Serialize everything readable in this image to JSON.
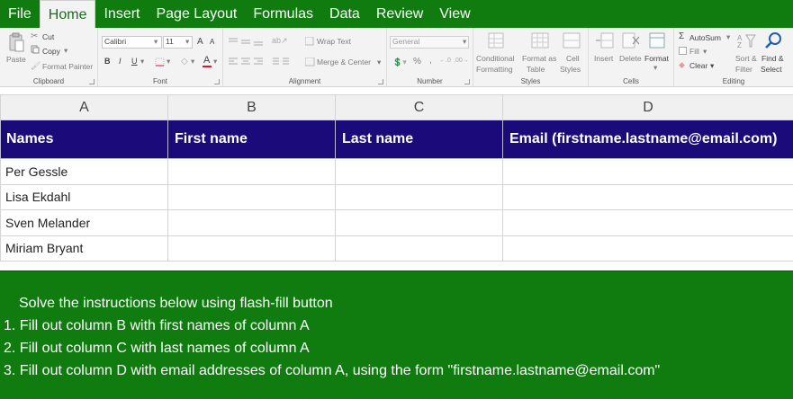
{
  "menu": {
    "items": [
      "File",
      "Home",
      "Insert",
      "Page Layout",
      "Formulas",
      "Data",
      "Review",
      "View"
    ],
    "active": "Home"
  },
  "ribbon": {
    "clipboard": {
      "label": "Clipboard",
      "paste": "Paste",
      "cut": "Cut",
      "copy": "Copy",
      "format_painter": "Format Painter"
    },
    "font": {
      "label": "Font",
      "font_name": "Calibri",
      "font_size": "11",
      "bold": "B",
      "italic": "I",
      "underline": "U",
      "grow": "A",
      "shrink": "A",
      "font_color_letter": "A",
      "font_color": "#e81123"
    },
    "alignment": {
      "label": "Alignment",
      "wrap_text": "Wrap Text",
      "merge_center": "Merge & Center"
    },
    "number": {
      "label": "Number",
      "format": "General",
      "percent": "%",
      "comma": ","
    },
    "styles": {
      "label": "Styles",
      "conditional_1": "Conditional",
      "conditional_2": "Formatting",
      "format_table_1": "Format as",
      "format_table_2": "Table",
      "cell_styles_1": "Cell",
      "cell_styles_2": "Styles"
    },
    "cells": {
      "label": "Cells",
      "insert": "Insert",
      "delete": "Delete",
      "format": "Format"
    },
    "editing": {
      "label": "Editing",
      "autosum": "AutoSum",
      "fill": "Fill",
      "clear": "Clear",
      "sort_1": "Sort &",
      "sort_2": "Filter",
      "find_1": "Find &",
      "find_2": "Select"
    }
  },
  "sheet": {
    "columns": [
      "A",
      "B",
      "C",
      "D"
    ],
    "header": [
      "Names",
      "First name",
      "Last name",
      "Email (firstname.lastname@email.com)"
    ],
    "rows": [
      [
        "Per Gessle",
        "",
        "",
        ""
      ],
      [
        "Lisa Ekdahl",
        "",
        "",
        ""
      ],
      [
        "Sven Melander",
        "",
        "",
        ""
      ],
      [
        "Miriam Bryant",
        "",
        "",
        ""
      ]
    ],
    "header_bg": "#1b0a7a"
  },
  "instructions": {
    "title": "Solve the instructions below using flash-fill button",
    "lines": [
      "1. Fill out column B with first names of column A",
      "2. Fill out column C with last names of column A",
      "3. Fill out column D with email addresses of column A, using the form \"firstname.lastname@email.com\""
    ],
    "bg": "#107c10"
  }
}
